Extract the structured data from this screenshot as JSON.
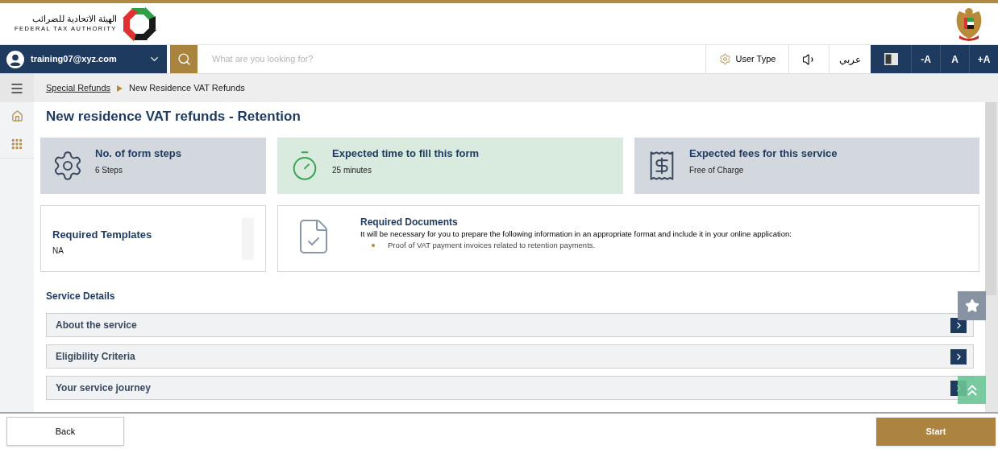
{
  "header": {
    "logo_arabic": "الهيئة الاتحادية للضرائب",
    "logo_english": "FEDERAL TAX AUTHORITY"
  },
  "nav": {
    "user": "training07@xyz.com",
    "search": {
      "placeholder": "What are you looking for?"
    },
    "user_type": "User Type",
    "language": "عربي",
    "font_sizes": [
      "-A",
      "A",
      "+A"
    ]
  },
  "breadcrumb": [
    {
      "label": "Special Refunds",
      "kind": "link"
    },
    {
      "label": "New Residence VAT Refunds",
      "kind": "current"
    }
  ],
  "title": "New residence VAT refunds - Retention",
  "info_cards": [
    {
      "kind": "steps",
      "title": "No. of form steps",
      "value": "6 Steps"
    },
    {
      "kind": "time",
      "title": "Expected time to fill this form",
      "value": "25 minutes"
    },
    {
      "kind": "fees",
      "title": "Expected fees for this service",
      "value": "Free of Charge"
    }
  ],
  "templates": {
    "title": "Required Templates",
    "value": "NA"
  },
  "documents": {
    "title": "Required Documents",
    "intro": "It will be necessary for you to prepare the following information in an appropriate format and include it in your online application:",
    "items": [
      "Proof of VAT payment invoices related to retention payments."
    ]
  },
  "service_details": {
    "title": "Service Details",
    "sections": [
      {
        "label": "About the service",
        "expanded": false
      },
      {
        "label": "Eligibility Criteria",
        "expanded": false
      },
      {
        "label": "Your service journey",
        "expanded": false
      }
    ]
  },
  "footer": {
    "back": "Back",
    "start": "Start"
  }
}
